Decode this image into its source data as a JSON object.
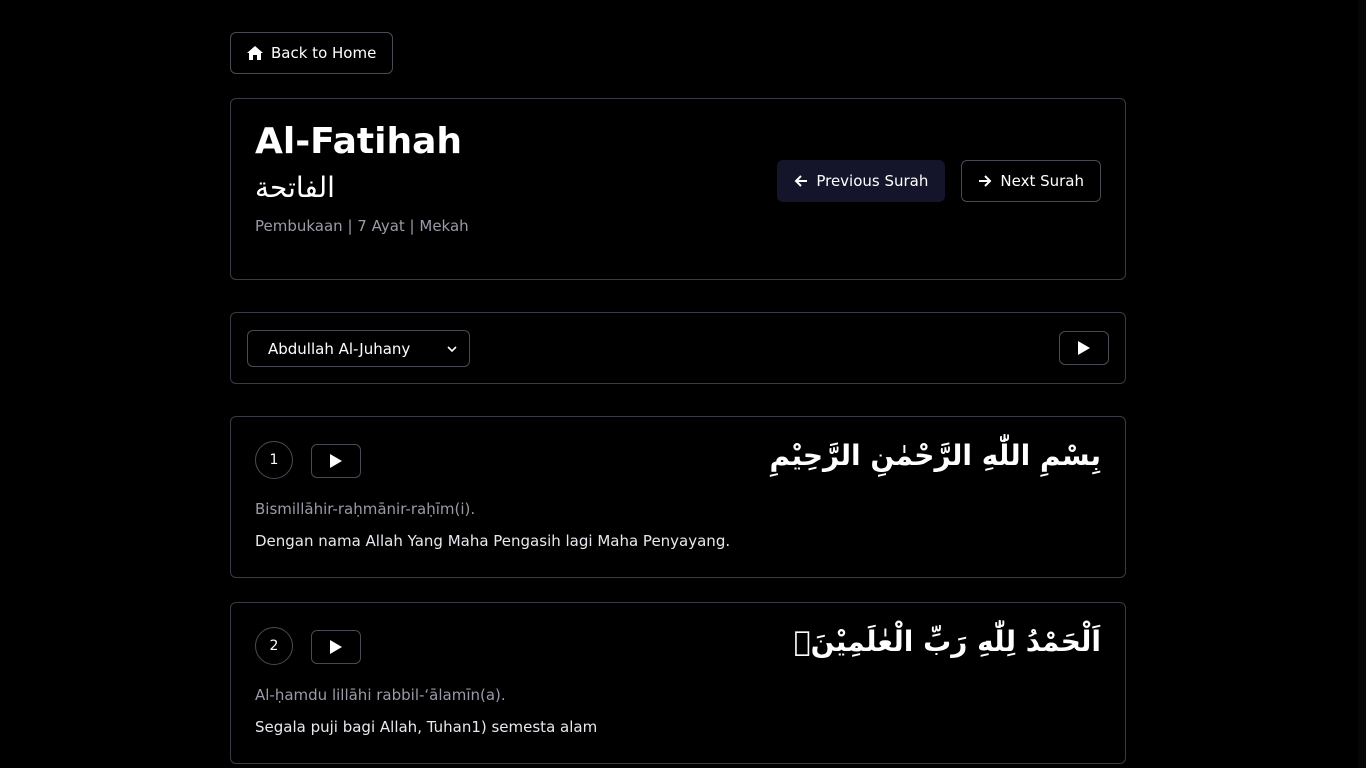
{
  "nav": {
    "back_label": "Back to Home",
    "prev_label": "Previous Surah",
    "next_label": "Next Surah"
  },
  "surah": {
    "name": "Al-Fatihah",
    "arabic": "الفاتحة",
    "meta": "Pembukaan | 7 Ayat | Mekah"
  },
  "player": {
    "reciter": "Abdullah Al-Juhany"
  },
  "ayahs": [
    {
      "number": "1",
      "arabic": "بِسْمِ اللّٰهِ الرَّحْمٰنِ الرَّحِيْمِ",
      "latin": "Bismillāhir-raḥmānir-raḥīm(i).",
      "translation": "Dengan nama Allah Yang Maha Pengasih lagi Maha Penyayang."
    },
    {
      "number": "2",
      "arabic": "اَلْحَمْدُ لِلّٰهِ رَبِّ الْعٰلَمِيْنَۙ",
      "latin": "Al-ḥamdu lillāhi rabbil-‘ālamīn(a).",
      "translation": "Segala puji bagi Allah, Tuhan1) semesta alam"
    }
  ]
}
